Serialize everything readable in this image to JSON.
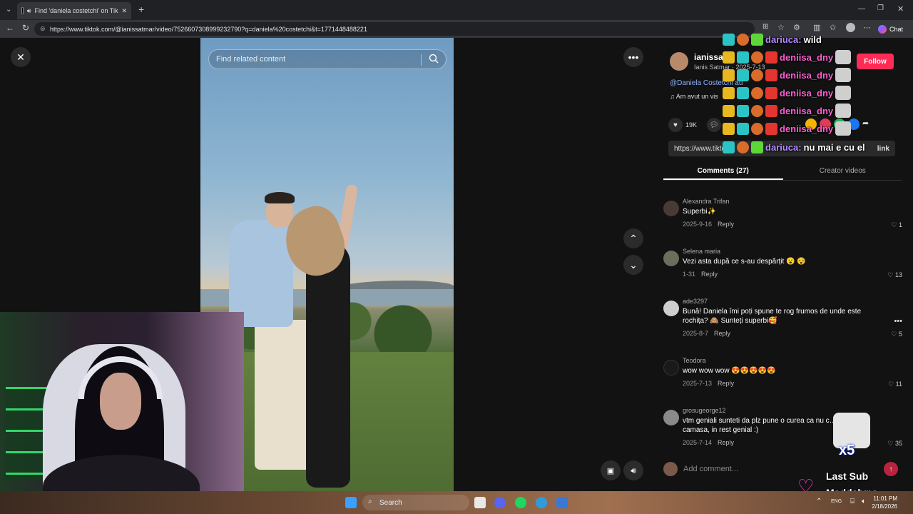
{
  "browser": {
    "tab_title": "Find 'daniela costetchi' on Tik",
    "url": "https://www.tiktok.com/@ianissatmar/video/7526607308999232790?q=daniela%20costetchi&t=1771448488221",
    "chat_label": "Chat"
  },
  "search": {
    "placeholder": "Find related content"
  },
  "author": {
    "name": "ianissa",
    "sub": "Ianis Satmar · 2025-7-13",
    "follow": "Follow",
    "mention": "@Daniela Costetchi au",
    "music": "♫  Am avut un vis"
  },
  "actions": {
    "likes": "19K",
    "copy_url": "https://www.tikto",
    "copy_link": "link"
  },
  "tabs": {
    "comments": "Comments (27)",
    "creator": "Creator videos"
  },
  "comments": [
    {
      "user": "Alexandra Trifan",
      "text": "Superbi✨",
      "date": "2025-9-16",
      "reply": "Reply",
      "likes": "1"
    },
    {
      "user": "Selena maria",
      "text": "Vezi asta după ce s-au despărțit 😮 😵",
      "date": "1-31",
      "reply": "Reply",
      "likes": "13"
    },
    {
      "user": "ade3297",
      "text": "Bună! Daniela îmi poți spune te rog frumos de unde este rochița? 🙈 Sunteți superbi🥰",
      "date": "2025-8-7",
      "reply": "Reply",
      "likes": "5"
    },
    {
      "user": "Teodora",
      "text": "wow wow wow 😍😍😍😍😍",
      "date": "2025-7-13",
      "reply": "Reply",
      "likes": "11"
    },
    {
      "user": "grosugeorge12",
      "text": "vtm geniali sunteti da plz pune o curea ca nu c… șnur la camasa, in rest genial :)",
      "date": "2025-7-14",
      "reply": "Reply",
      "likes": "35"
    }
  ],
  "add_comment": {
    "placeholder": "Add comment..."
  },
  "chat_overlay": [
    {
      "name": "dariuca:",
      "msg": "wild"
    },
    {
      "name": "deniisa_dny",
      "msg": ""
    },
    {
      "name": "deniisa_dny",
      "msg": ""
    },
    {
      "name": "deniisa_dny",
      "msg": ""
    },
    {
      "name": "deniisa_dny",
      "msg": ""
    },
    {
      "name": "deniisa_dny",
      "msg": ""
    },
    {
      "name": "dariuca:",
      "msg": "nu mai e cu el"
    }
  ],
  "overlay": {
    "x5": "x5",
    "last_sub_label": "Last Sub",
    "last_sub_name": "Maddalyna"
  },
  "taskbar": {
    "search": "Search",
    "lang": "ENG",
    "time": "11:01 PM",
    "date": "2/18/2026"
  }
}
